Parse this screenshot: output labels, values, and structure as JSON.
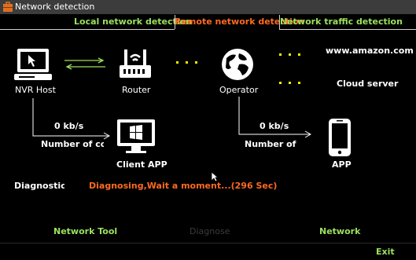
{
  "window": {
    "title": "Network detection"
  },
  "tabs": [
    {
      "label": "Local network detection"
    },
    {
      "label": "Remote network detection"
    },
    {
      "label": "Network traffic detection"
    }
  ],
  "nodes": {
    "nvr_host": "NVR Host",
    "router": "Router",
    "operator": "Operator",
    "client_app": "Client APP",
    "app": "APP",
    "amazon": "www.amazon.com",
    "cloud": "Cloud server"
  },
  "links": {
    "left_speed": "0 kb/s",
    "left_label": "Number of co",
    "right_speed": "0 kb/s",
    "right_label": "Number of co"
  },
  "diagnostic_label": "Diagnostic Re",
  "status_text": "Diagnosing,Wait a moment...(296 Sec)",
  "buttons": {
    "network_tool": "Network Tool",
    "diagnose": "Diagnose",
    "network": "Network",
    "exit": "Exit"
  },
  "colors": {
    "active": "#ff6a1f",
    "accent": "#9be15d",
    "disabled": "#3c3c3c"
  }
}
